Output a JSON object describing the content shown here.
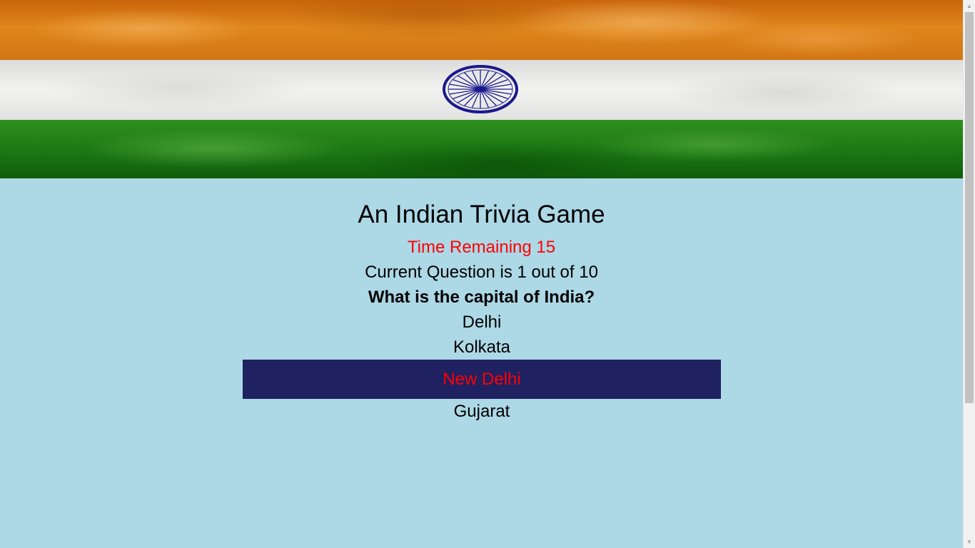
{
  "header": {
    "banner_icon": "indian-flag-banner",
    "wheel_icon": "ashoka-chakra-icon",
    "colors": {
      "saffron": "#d9771a",
      "white": "#eeeeec",
      "green": "#1d7a14",
      "chakra": "#1a1a8c"
    }
  },
  "game": {
    "title": "An Indian Trivia Game",
    "timer_text": "Time Remaining 15",
    "progress_text": "Current Question is 1 out of 10",
    "question": "What is the capital of India?",
    "answers": [
      {
        "label": "Delhi"
      },
      {
        "label": "Kolkata"
      },
      {
        "label": "New Delhi",
        "highlighted": true
      },
      {
        "label": "Gujarat"
      }
    ],
    "colors": {
      "background": "#add8e6",
      "timer": "#ff0000",
      "highlight_bg": "#1f2160",
      "highlight_text": "#ff0000"
    }
  },
  "scrollbar": {
    "up_icon": "scroll-up-arrow-icon",
    "down_icon": "scroll-down-arrow-icon"
  }
}
